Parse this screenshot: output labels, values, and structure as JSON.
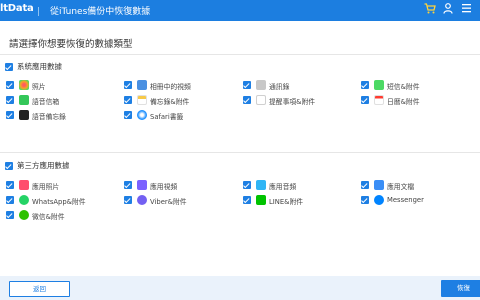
{
  "titlebar": {
    "app_name": "ltData",
    "title": "從iTunes備份中恢復數據",
    "cart_icon": "cart-icon",
    "user_icon": "user-icon",
    "menu_icon": "menu-icon"
  },
  "prompt": "請選擇你想要恢復的數據類型",
  "system_section": {
    "title": "系統應用數據",
    "items": [
      {
        "label": "照片",
        "icon": "photos-icon",
        "color": "#f5a623"
      },
      {
        "label": "相冊中的視頻",
        "icon": "video-icon",
        "color": "#4a90e2"
      },
      {
        "label": "通訊錄",
        "icon": "contacts-icon",
        "color": "#9b9b9b"
      },
      {
        "label": "短信&附件",
        "icon": "messages-icon",
        "color": "#4cd964"
      },
      {
        "label": "語音信箱",
        "icon": "voicemail-icon",
        "color": "#34c759"
      },
      {
        "label": "備忘錄&附件",
        "icon": "notes-icon",
        "color": "#f7c948"
      },
      {
        "label": "提醒事項&附件",
        "icon": "reminders-icon",
        "color": "#ffffff"
      },
      {
        "label": "日曆&附件",
        "icon": "calendar-icon",
        "color": "#ff3b30"
      },
      {
        "label": "語音備忘錄",
        "icon": "voice-memo-icon",
        "color": "#222222"
      },
      {
        "label": "Safari書籤",
        "icon": "safari-icon",
        "color": "#1e90ff"
      }
    ]
  },
  "third_party_section": {
    "title": "第三方應用數據",
    "items": [
      {
        "label": "應用照片",
        "icon": "app-photos-icon",
        "color": "#ff4d6d"
      },
      {
        "label": "應用視頻",
        "icon": "app-video-icon",
        "color": "#7b61ff"
      },
      {
        "label": "應用音頻",
        "icon": "app-audio-icon",
        "color": "#2fb5f5"
      },
      {
        "label": "應用文檔",
        "icon": "app-docs-icon",
        "color": "#3a8ef6"
      },
      {
        "label": "WhatsApp&附件",
        "icon": "whatsapp-icon",
        "color": "#25d366"
      },
      {
        "label": "Viber&附件",
        "icon": "viber-icon",
        "color": "#7360f2"
      },
      {
        "label": "LINE&附件",
        "icon": "line-icon",
        "color": "#00c300"
      },
      {
        "label": "Messenger",
        "icon": "messenger-icon",
        "color": "#0084ff"
      },
      {
        "label": "微信&附件",
        "icon": "wechat-icon",
        "color": "#2dc100"
      }
    ]
  },
  "footer": {
    "back_label": "返回",
    "restore_label": "恢復"
  }
}
